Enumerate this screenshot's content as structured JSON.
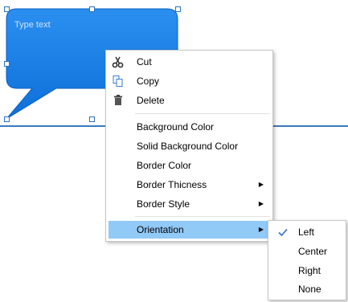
{
  "canvas": {
    "bubble_placeholder": "Type text",
    "accent_color": "#1e7fe8",
    "line_color": "#3a78c2"
  },
  "context_menu": {
    "items": [
      {
        "label": "Cut",
        "icon": "scissors-icon"
      },
      {
        "label": "Copy",
        "icon": "copy-icon"
      },
      {
        "label": "Delete",
        "icon": "trash-icon"
      },
      {
        "label": "Background Color"
      },
      {
        "label": "Solid Background Color"
      },
      {
        "label": "Border Color"
      },
      {
        "label": "Border Thicness",
        "submenu": true
      },
      {
        "label": "Border Style",
        "submenu": true
      },
      {
        "label": "Orientation",
        "submenu": true,
        "highlighted": true
      }
    ],
    "highlight_color": "#91c9f7"
  },
  "orientation_submenu": {
    "items": [
      {
        "label": "Left",
        "checked": true
      },
      {
        "label": "Center"
      },
      {
        "label": "Right"
      },
      {
        "label": "None"
      }
    ]
  }
}
